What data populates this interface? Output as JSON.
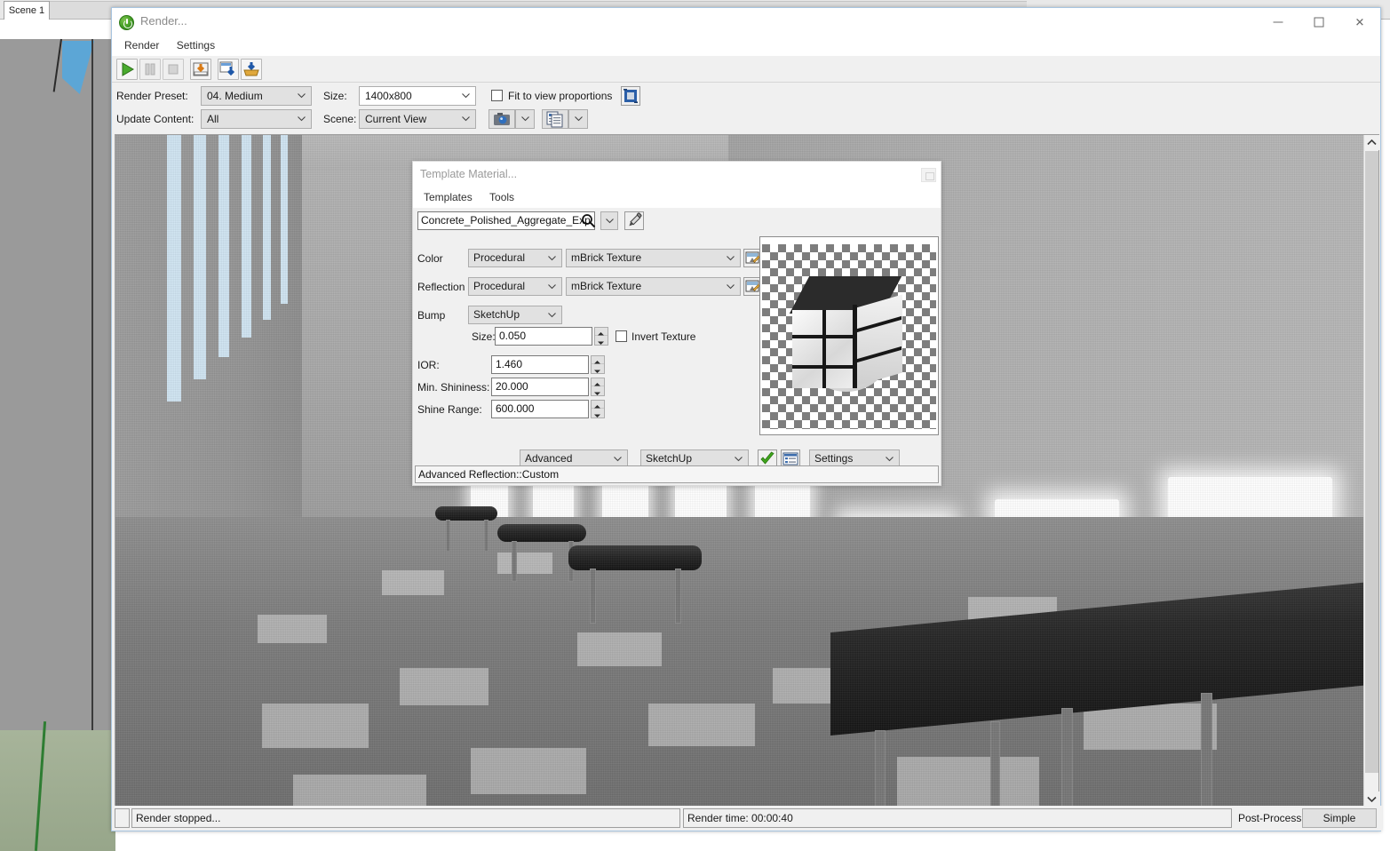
{
  "background_app": {
    "scene_tab_label": "Scene 1"
  },
  "render_window": {
    "title": "Render...",
    "app_icon": "power-render-icon",
    "window_controls": {
      "minimize": "minimize-icon",
      "maximize": "maximize-icon",
      "close": "close-icon"
    },
    "menu": [
      "Render",
      "Settings"
    ],
    "toolbar": [
      {
        "name": "start-render-button",
        "icon": "play-icon",
        "enabled": true
      },
      {
        "name": "pause-render-button",
        "icon": "pause-icon",
        "enabled": false
      },
      {
        "name": "stop-render-button",
        "icon": "stop-icon",
        "enabled": false
      },
      {
        "name": "save-image-button",
        "icon": "save-image-icon",
        "enabled": true
      },
      {
        "name": "save-with-alpha-button",
        "icon": "save-alpha-icon",
        "enabled": true
      },
      {
        "name": "load-image-button",
        "icon": "load-image-icon",
        "enabled": true
      }
    ],
    "settings": {
      "render_preset_label": "Render Preset:",
      "render_preset_value": "04. Medium",
      "size_label": "Size:",
      "size_value": "1400x800",
      "fit_to_view_label": "Fit to view proportions",
      "fit_to_view_checked": false,
      "fit_icon": "fit-to-view-icon",
      "update_content_label": "Update Content:",
      "update_content_value": "All",
      "scene_label": "Scene:",
      "scene_value": "Current View",
      "camera_button_icon": "camera-icon",
      "scenes_button_icon": "scenes-list-icon"
    },
    "status_bar": {
      "message": "Render stopped...",
      "render_time": "Render time: 00:00:40",
      "post_process_label": "Post-Process:",
      "post_process_value": "Simple"
    },
    "scrollbar": {
      "up_arrow": "chevron-up-icon",
      "down_arrow": "chevron-down-icon"
    }
  },
  "material_dialog": {
    "title": "Template Material...",
    "restore_icon": "restore-icon",
    "menu": [
      "Templates",
      "Tools"
    ],
    "material_name": "Concrete_Polished_Aggregate_Exp",
    "search_icon": "search-icon",
    "dropdown_icon": "chevron-down-icon",
    "eyedropper_icon": "eyedropper-icon",
    "rows": [
      {
        "label": "Color",
        "type_value": "Procedural",
        "texture_value": "mBrick Texture",
        "edit_icon": "texture-edit-icon"
      },
      {
        "label": "Reflection",
        "type_value": "Procedural",
        "texture_value": "mBrick Texture",
        "edit_icon": "texture-edit-icon"
      },
      {
        "label": "Bump",
        "type_value": "SketchUp"
      }
    ],
    "bump_size_label": "Size:",
    "bump_size_value": "0.050",
    "invert_texture_label": "Invert Texture",
    "invert_texture_checked": false,
    "numeric_fields": [
      {
        "label": "IOR:",
        "value": "1.460"
      },
      {
        "label": "Min. Shininess:",
        "value": "20.000"
      },
      {
        "label": "Shine Range:",
        "value": "600.000"
      }
    ],
    "footer": {
      "mode_value": "Advanced",
      "engine_value": "SketchUp",
      "apply_icon": "green-check-icon",
      "list_icon": "list-view-icon",
      "settings_value": "Settings"
    },
    "status_text": "Advanced Reflection::Custom",
    "preview_alt": "material-preview-cube-on-checkerboard"
  },
  "colors": {
    "accent_green": "#3f9a22",
    "dialog_bg": "#f0f0f0",
    "combo_bg": "#e1e1e1",
    "border": "#adadad",
    "title_text": "#8a8a8a"
  }
}
